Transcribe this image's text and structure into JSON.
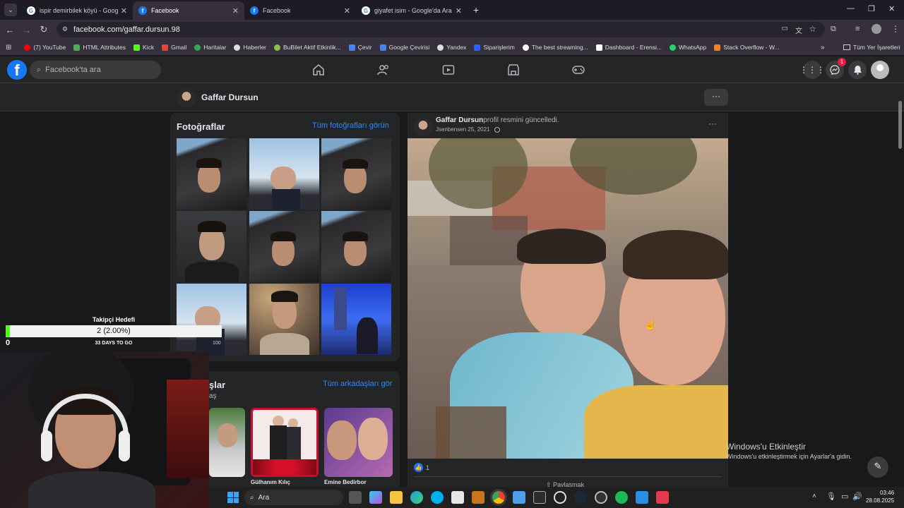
{
  "tabs": [
    {
      "title": "ispir demirbilek köyü - Google'ı",
      "active": false,
      "icon": "google-icon"
    },
    {
      "title": "Facebook",
      "active": true,
      "icon": "facebook-icon"
    },
    {
      "title": "Facebook",
      "active": false,
      "icon": "facebook-icon"
    },
    {
      "title": "giyafet isim - Google'da Ara",
      "active": false,
      "icon": "google-icon"
    }
  ],
  "url": "facebook.com/gaffar.dursun.98",
  "bookmarks": [
    "(7) YouTube",
    "HTML Attributes",
    "Kick",
    "Gmail",
    "Haritalar",
    "Haberler",
    "BuBilet Aktif Etkinlik...",
    "Çevir",
    "Google Çevirisi",
    "Yandex",
    "Siparişlerim",
    "The best streaming...",
    "Dashboard - Erensi...",
    "WhatsApp",
    "Stack Overflow - W..."
  ],
  "bookmarks_all": "Tüm Yer İşaretleri",
  "fb": {
    "search_placeholder": "Facebook'ta ara",
    "notif_badge": "1",
    "profile_name": "Gaffar Dursun",
    "photos_title": "Fotoğraflar",
    "photos_link": "Tüm fotoğrafları görün",
    "friends_title": "şlar",
    "friends_sub": "aş",
    "friends_link": "Tüm arkadaşları gör",
    "friends": [
      "",
      "Gülhanım Kılıç",
      "Emine Bedirbor"
    ],
    "post": {
      "author": "Gaffar Dursun",
      "action": "profil resmini güncelledi.",
      "date": "Jsenbensen 25, 2021",
      "likes": "1",
      "share_label": "Paylaşmak"
    }
  },
  "overlay": {
    "goal_title": "Takipçi Hedefi",
    "goal_value": "2 (2.00%)",
    "goal_progress_pct": 2,
    "goal_start": "0",
    "goal_end": "100",
    "days": "33 DAYS TO GO"
  },
  "watermark": {
    "title": "Windows'u Etkinleştir",
    "sub": "Windows'u etkinleştirmek için Ayarlar'a gidin."
  },
  "taskbar": {
    "search": "Ara",
    "time": "03:46",
    "date": "28.08.2025"
  }
}
